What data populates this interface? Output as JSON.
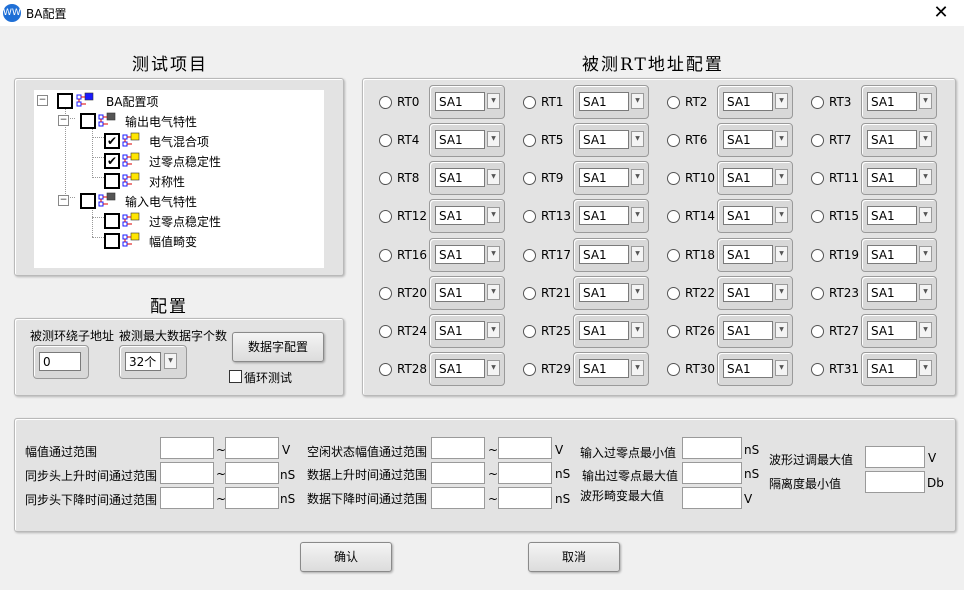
{
  "window": {
    "icon": "WWW",
    "title": "BA配置",
    "close": "✕"
  },
  "test_items": {
    "title": "测试项目",
    "tree": [
      {
        "label": "BA配置项",
        "expander": "−",
        "checked": "",
        "icon_color": "#1a1aff"
      },
      {
        "label": "输出电气特性",
        "expander": "−",
        "checked": "",
        "icon_color": "#555"
      },
      {
        "label": "电气混合项",
        "checked": "✔",
        "icon_color": "#ffe600"
      },
      {
        "label": "过零点稳定性",
        "checked": "✔",
        "icon_color": "#ffe600"
      },
      {
        "label": "对称性",
        "checked": "",
        "icon_color": "#ffe600"
      },
      {
        "label": "输入电气特性",
        "expander": "−",
        "checked": "",
        "icon_color": "#555"
      },
      {
        "label": "过零点稳定性",
        "checked": "",
        "icon_color": "#ffe600"
      },
      {
        "label": "幅值畸变",
        "checked": "",
        "icon_color": "#ffe600"
      }
    ]
  },
  "config": {
    "title": "配置",
    "subaddr_label": "被测环绕子地址",
    "subaddr_value": "0",
    "maxwords_label": "被测最大数据字个数",
    "maxwords_value": "32个",
    "dataword_button": "数据字配置",
    "loop_label": "循环测试"
  },
  "rt_config": {
    "title": "被测RT地址配置",
    "items": [
      {
        "label": "RT0",
        "value": "SA1"
      },
      {
        "label": "RT1",
        "value": "SA1"
      },
      {
        "label": "RT2",
        "value": "SA1"
      },
      {
        "label": "RT3",
        "value": "SA1"
      },
      {
        "label": "RT4",
        "value": "SA1"
      },
      {
        "label": "RT5",
        "value": "SA1"
      },
      {
        "label": "RT6",
        "value": "SA1"
      },
      {
        "label": "RT7",
        "value": "SA1"
      },
      {
        "label": "RT8",
        "value": "SA1"
      },
      {
        "label": "RT9",
        "value": "SA1"
      },
      {
        "label": "RT10",
        "value": "SA1"
      },
      {
        "label": "RT11",
        "value": "SA1"
      },
      {
        "label": "RT12",
        "value": "SA1"
      },
      {
        "label": "RT13",
        "value": "SA1"
      },
      {
        "label": "RT14",
        "value": "SA1"
      },
      {
        "label": "RT15",
        "value": "SA1"
      },
      {
        "label": "RT16",
        "value": "SA1"
      },
      {
        "label": "RT17",
        "value": "SA1"
      },
      {
        "label": "RT18",
        "value": "SA1"
      },
      {
        "label": "RT19",
        "value": "SA1"
      },
      {
        "label": "RT20",
        "value": "SA1"
      },
      {
        "label": "RT21",
        "value": "SA1"
      },
      {
        "label": "RT22",
        "value": "SA1"
      },
      {
        "label": "RT23",
        "value": "SA1"
      },
      {
        "label": "RT24",
        "value": "SA1"
      },
      {
        "label": "RT25",
        "value": "SA1"
      },
      {
        "label": "RT26",
        "value": "SA1"
      },
      {
        "label": "RT27",
        "value": "SA1"
      },
      {
        "label": "RT28",
        "value": "SA1"
      },
      {
        "label": "RT29",
        "value": "SA1"
      },
      {
        "label": "RT30",
        "value": "SA1"
      },
      {
        "label": "RT31",
        "value": "SA1"
      }
    ]
  },
  "ranges": {
    "amp_range": "幅值通过范围",
    "amp_unit": "V",
    "sync_rise": "同步头上升时间通过范围",
    "sync_rise_unit": "nS",
    "sync_fall": "同步头下降时间通过范围",
    "sync_fall_unit": "nS",
    "idle_amp": "空闲状态幅值通过范围",
    "idle_amp_unit": "V",
    "data_rise": "数据上升时间通过范围",
    "data_rise_unit": "nS",
    "data_fall": "数据下降时间通过范围",
    "data_fall_unit": "nS",
    "tilde": "~",
    "in_zero_min": "输入过零点最小值",
    "in_zero_min_unit": "nS",
    "out_zero_max": "输出过零点最大值",
    "out_zero_max_unit": "nS",
    "wave_distort_max": "波形畸变最大值",
    "wave_distort_max_unit": "V",
    "overshoot_max": "波形过调最大值",
    "overshoot_max_unit": "V",
    "isolation_min": "隔离度最小值",
    "isolation_min_unit": "Db"
  },
  "footer": {
    "ok": "确认",
    "cancel": "取消"
  }
}
